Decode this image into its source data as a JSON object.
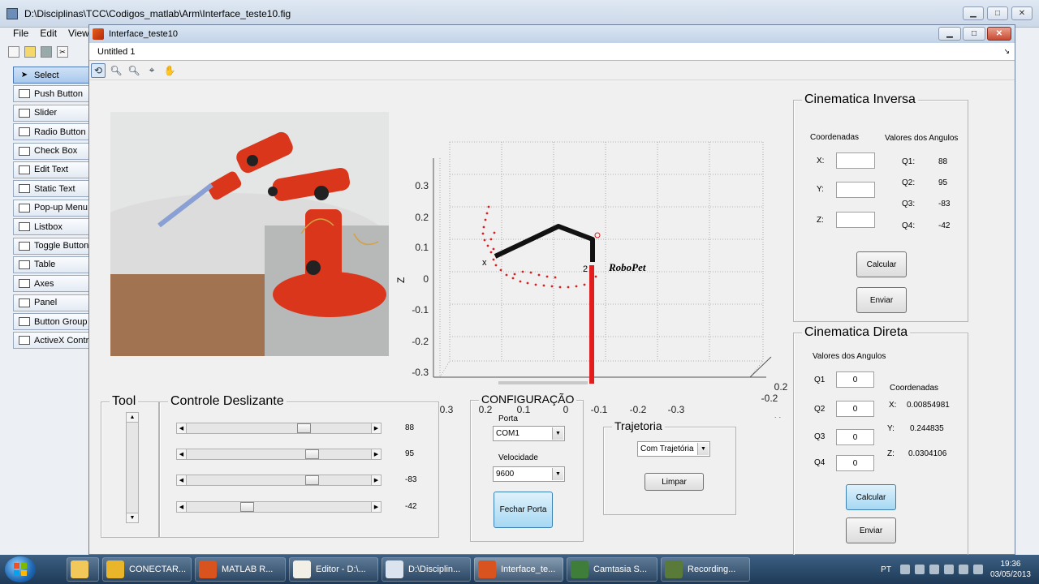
{
  "guide": {
    "title": "D:\\Disciplinas\\TCC\\Codigos_matlab\\Arm\\Interface_teste10.fig",
    "menu": [
      "File",
      "Edit",
      "View"
    ],
    "palette": [
      {
        "label": "Select",
        "icon": "arrow-icon"
      },
      {
        "label": "Push Button",
        "icon": "push-button-icon"
      },
      {
        "label": "Slider",
        "icon": "slider-icon"
      },
      {
        "label": "Radio Button",
        "icon": "radio-icon"
      },
      {
        "label": "Check Box",
        "icon": "checkbox-icon"
      },
      {
        "label": "Edit Text",
        "icon": "edit-text-icon"
      },
      {
        "label": "Static Text",
        "icon": "static-text-icon"
      },
      {
        "label": "Pop-up Menu",
        "icon": "popup-icon"
      },
      {
        "label": "Listbox",
        "icon": "listbox-icon"
      },
      {
        "label": "Toggle Button",
        "icon": "toggle-icon"
      },
      {
        "label": "Table",
        "icon": "table-icon"
      },
      {
        "label": "Axes",
        "icon": "axes-icon"
      },
      {
        "label": "Panel",
        "icon": "panel-icon"
      },
      {
        "label": "Button Group",
        "icon": "button-group-icon"
      },
      {
        "label": "ActiveX Control",
        "icon": "activex-icon"
      }
    ]
  },
  "figure": {
    "title": "Interface_teste10",
    "doc_tab": "Untitled 1"
  },
  "plot": {
    "zlabel": "Z",
    "ylabel": "Y",
    "xlabel": "X",
    "z_ticks": [
      "0.3",
      "0.2",
      "0.1",
      "0",
      "-0.1",
      "-0.2",
      "-0.3"
    ],
    "y_ticks": [
      "0.3",
      "0.2",
      "0.1",
      "0",
      "-0.1",
      "-0.2",
      "-0.3"
    ],
    "x_ticks": [
      "0.2",
      "-0.2"
    ],
    "robot_label": "RoboPet",
    "marker_x": "x",
    "marker_2": "2"
  },
  "tool_panel": {
    "title": "Tool"
  },
  "controle": {
    "title": "Controle Deslizante",
    "sliders": [
      {
        "value": "88",
        "level": 0.64
      },
      {
        "value": "95",
        "level": 0.69
      },
      {
        "value": "-83",
        "level": 0.69
      },
      {
        "value": "-42",
        "level": 0.31
      }
    ]
  },
  "config": {
    "title": "CONFIGURAÇÃO",
    "porta_label": "Porta",
    "porta_value": "COM1",
    "velocidade_label": "Velocidade",
    "velocidade_value": "9600",
    "fechar_button": "Fechar Porta"
  },
  "trajetoria": {
    "title": "Trajetoria",
    "select_value": "Com Trajetória",
    "limpar_button": "Limpar"
  },
  "inversa": {
    "title": "Cinematica Inversa",
    "coord_label": "Coordenadas",
    "angles_label": "Valores dos Angulos",
    "x_label": "X:",
    "y_label": "Y:",
    "z_label": "Z:",
    "x_value": "",
    "y_value": "",
    "z_value": "",
    "q1_label": "Q1:",
    "q1": "88",
    "q2_label": "Q2:",
    "q2": "95",
    "q3_label": "Q3:",
    "q3": "-83",
    "q4_label": "Q4:",
    "q4": "-42",
    "calcular_button": "Calcular",
    "enviar_button": "Enviar"
  },
  "direta": {
    "title": "Cinematica Direta",
    "angles_label": "Valores dos Angulos",
    "q1_label": "Q1",
    "q1": "0",
    "q2_label": "Q2",
    "q2": "0",
    "q3_label": "Q3",
    "q3": "0",
    "q4_label": "Q4",
    "q4": "0",
    "coord_label": "Coordenadas",
    "x_label": "X:",
    "x_value": "0.00854981",
    "y_label": "Y:",
    "y_value": "0.244835",
    "z_label": "Z:",
    "z_value": "0.0304106",
    "calcular_button": "Calcular",
    "enviar_button": "Enviar"
  },
  "taskbar": {
    "items": [
      {
        "label": "CONECTAR...",
        "color": "#e9b52b"
      },
      {
        "label": "MATLAB  R...",
        "color": "#d9531e"
      },
      {
        "label": "Editor - D:\\...",
        "color": "#f2efe6"
      },
      {
        "label": "D:\\Disciplin...",
        "color": "#dbe4ee"
      },
      {
        "label": "Interface_te...",
        "color": "#d9531e"
      },
      {
        "label": "Camtasia S...",
        "color": "#3e7d3a"
      },
      {
        "label": "Recording...",
        "color": "#5a7a3a"
      }
    ],
    "lang": "PT",
    "time": "19:36",
    "date": "03/05/2013"
  }
}
